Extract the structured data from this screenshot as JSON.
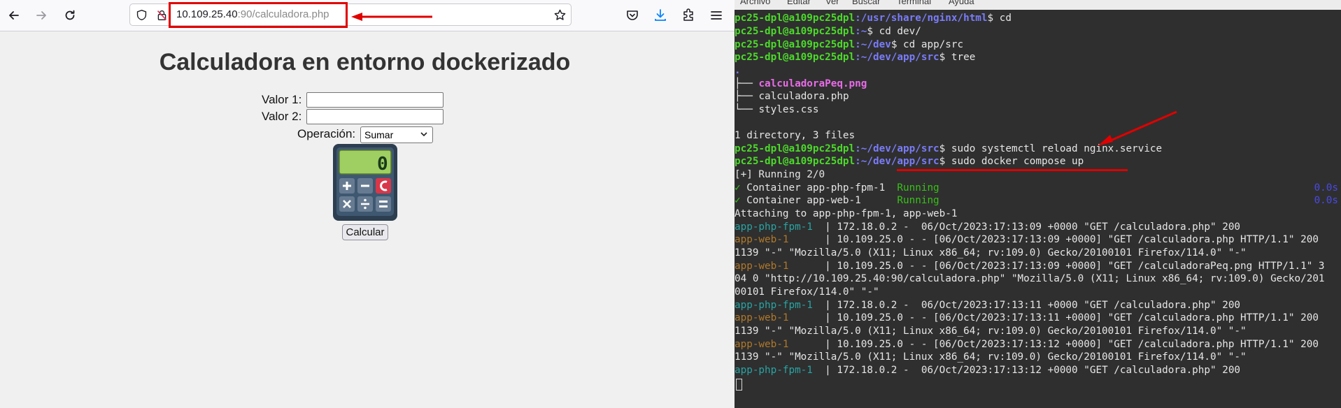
{
  "browser": {
    "url_host": "10.109.25.40",
    "url_rest": ":90/calculadora.php",
    "nav": {
      "back": "arrow-left-icon",
      "forward": "arrow-right-icon",
      "reload": "reload-icon"
    },
    "annotation_color": "#e00000"
  },
  "page": {
    "title": "Calculadora en entorno dockerizado",
    "label_valor1": "Valor 1:",
    "label_valor2": "Valor 2:",
    "label_operacion": "Operación:",
    "select_value": "Sumar",
    "calc_display": "0",
    "submit_label": "Calcular"
  },
  "terminal": {
    "menu": [
      "Archivo",
      "Editar",
      "Ver",
      "Buscar",
      "Terminal",
      "Ayuda"
    ],
    "prompt_user": "pc25-dpl@a109pc25dpl",
    "lines": [
      {
        "path": ":/usr/share/nginx/html",
        "cmd": "$ cd"
      },
      {
        "path": ":~",
        "cmd": "$ cd dev/"
      },
      {
        "path": ":~/dev",
        "cmd": "$ cd app/src"
      },
      {
        "path": ":~/dev/app/src",
        "cmd": "$ tree"
      }
    ],
    "tree": {
      "root": ".",
      "files": [
        "calculadoraPeq.png",
        "calculadora.php",
        "styles.css"
      ],
      "summary": "1 directory, 3 files"
    },
    "cmd_reload": {
      "path": ":~/dev/app/src",
      "cmd": "$ sudo systemctl reload nginx.service"
    },
    "cmd_compose": {
      "path": ":~/dev/app/src",
      "dollar": "$ ",
      "cmd": "sudo docker compose up"
    },
    "compose": {
      "running": "[+] Running 2/0",
      "containers": [
        {
          "check": "✓",
          "name": " Container app-php-fpm-1  ",
          "status": "Running",
          "time": "0.0s"
        },
        {
          "check": "✓",
          "name": " Container app-web-1      ",
          "status": "Running",
          "time": "0.0s"
        }
      ],
      "attaching": "Attaching to app-php-fpm-1, app-web-1"
    },
    "logs": [
      {
        "svc": "app-php-fpm-1  ",
        "cls": "cyan",
        "text": "| 172.18.0.2 -  06/Oct/2023:17:13:09 +0000 \"GET /calculadora.php\" 200"
      },
      {
        "svc": "app-web-1      ",
        "cls": "orange",
        "text": "| 10.109.25.0 - - [06/Oct/2023:17:13:09 +0000] \"GET /calculadora.php HTTP/1.1\" 200"
      },
      {
        "svc": "",
        "cls": "",
        "text": "1139 \"-\" \"Mozilla/5.0 (X11; Linux x86_64; rv:109.0) Gecko/20100101 Firefox/114.0\" \"-\""
      },
      {
        "svc": "app-web-1      ",
        "cls": "orange",
        "text": "| 10.109.25.0 - - [06/Oct/2023:17:13:09 +0000] \"GET /calculadoraPeq.png HTTP/1.1\" 3"
      },
      {
        "svc": "",
        "cls": "",
        "text": "04 0 \"http://10.109.25.40:90/calculadora.php\" \"Mozilla/5.0 (X11; Linux x86_64; rv:109.0) Gecko/201"
      },
      {
        "svc": "",
        "cls": "",
        "text": "00101 Firefox/114.0\" \"-\""
      },
      {
        "svc": "app-php-fpm-1  ",
        "cls": "cyan",
        "text": "| 172.18.0.2 -  06/Oct/2023:17:13:11 +0000 \"GET /calculadora.php\" 200"
      },
      {
        "svc": "app-web-1      ",
        "cls": "orange",
        "text": "| 10.109.25.0 - - [06/Oct/2023:17:13:11 +0000] \"GET /calculadora.php HTTP/1.1\" 200"
      },
      {
        "svc": "",
        "cls": "",
        "text": "1139 \"-\" \"Mozilla/5.0 (X11; Linux x86_64; rv:109.0) Gecko/20100101 Firefox/114.0\" \"-\""
      },
      {
        "svc": "app-web-1      ",
        "cls": "orange",
        "text": "| 10.109.25.0 - - [06/Oct/2023:17:13:12 +0000] \"GET /calculadora.php HTTP/1.1\" 200"
      },
      {
        "svc": "",
        "cls": "",
        "text": "1139 \"-\" \"Mozilla/5.0 (X11; Linux x86_64; rv:109.0) Gecko/20100101 Firefox/114.0\" \"-\""
      },
      {
        "svc": "app-php-fpm-1  ",
        "cls": "cyan",
        "text": "| 172.18.0.2 -  06/Oct/2023:17:13:12 +0000 \"GET /calculadora.php\" 200"
      }
    ]
  }
}
